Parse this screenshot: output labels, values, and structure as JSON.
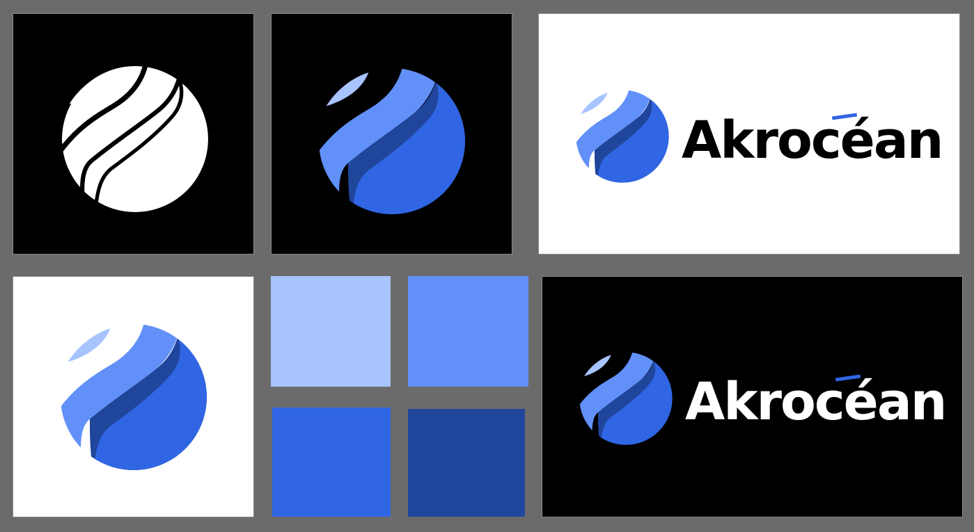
{
  "brand": {
    "wordmark": "Akrocéan"
  },
  "colors": {
    "canvas_gray": "#6b6b6b",
    "black": "#000000",
    "white": "#ffffff",
    "blue_light": "#a8c4ff",
    "blue_medium": "#6190f8",
    "blue_primary": "#3066e4",
    "blue_dark": "#20469c"
  },
  "palette": [
    {
      "name": "light-blue",
      "hex": "#a8c4ff"
    },
    {
      "name": "medium-blue",
      "hex": "#6190f8"
    },
    {
      "name": "primary-blue",
      "hex": "#3066e4"
    },
    {
      "name": "dark-blue",
      "hex": "#20469c"
    }
  ],
  "panels": [
    {
      "variant": "mono-white-on-black"
    },
    {
      "variant": "color-on-black"
    },
    {
      "variant": "horizontal-lockup-on-white"
    },
    {
      "variant": "color-on-white"
    },
    {
      "variant": "color-palette"
    },
    {
      "variant": "horizontal-lockup-on-black"
    }
  ]
}
